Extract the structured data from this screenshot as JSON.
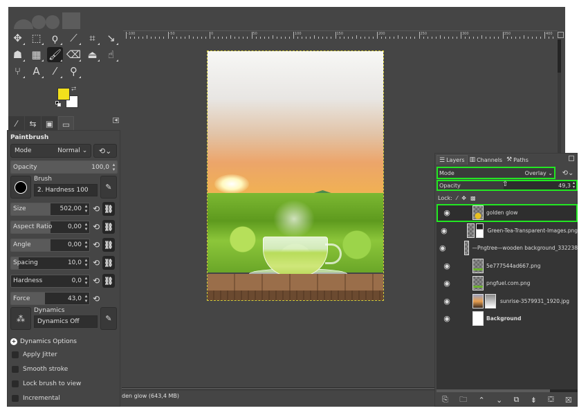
{
  "toolbox": {
    "tools": [
      {
        "name": "move-tool",
        "glyph": "✥"
      },
      {
        "name": "rect-select-tool",
        "glyph": "⬚"
      },
      {
        "name": "free-select-tool",
        "glyph": "ϙ"
      },
      {
        "name": "fuzzy-select-tool",
        "glyph": "⟋"
      },
      {
        "name": "crop-tool",
        "glyph": "⌗"
      },
      {
        "name": "unified-transform-tool",
        "glyph": "↘"
      },
      {
        "name": "warp-transform-tool",
        "glyph": "☗"
      },
      {
        "name": "gradient-tool",
        "glyph": "▦"
      },
      {
        "name": "paintbrush-tool",
        "glyph": "🖌",
        "active": true
      },
      {
        "name": "eraser-tool",
        "glyph": "⌫"
      },
      {
        "name": "clone-tool",
        "glyph": "⏏"
      },
      {
        "name": "smudge-tool",
        "glyph": "☝"
      },
      {
        "name": "paths-tool",
        "glyph": "⑂"
      },
      {
        "name": "text-tool",
        "glyph": "A"
      },
      {
        "name": "color-picker-tool",
        "glyph": "⁄"
      },
      {
        "name": "zoom-tool",
        "glyph": "⚲"
      }
    ],
    "foreground_color": "#f2e01c",
    "background_color": "#ffffff",
    "swap_glyph": "⮂",
    "dock_tabs": [
      {
        "name": "tool-options-tab",
        "glyph": "⁄"
      },
      {
        "name": "undo-history-tab",
        "glyph": "⇆"
      },
      {
        "name": "images-tab",
        "glyph": "▣"
      },
      {
        "name": "device-status-tab",
        "glyph": "▭"
      }
    ]
  },
  "tool_options": {
    "title": "Paintbrush",
    "mode_label": "Mode",
    "mode_value": "Normal",
    "opacity": {
      "label": "Opacity",
      "value": "100,0",
      "fraction": 1.0
    },
    "brush_label": "Brush",
    "brush_name": "2. Hardness 100",
    "sliders": [
      {
        "key": "size",
        "label": "Size",
        "value": "502,00",
        "fraction": 0.5,
        "has_chain": true
      },
      {
        "key": "aspect-ratio",
        "label": "Aspect Ratio",
        "value": "0,00",
        "fraction": 0.5,
        "has_chain": true
      },
      {
        "key": "angle",
        "label": "Angle",
        "value": "0,00",
        "fraction": 0.5,
        "has_chain": true
      },
      {
        "key": "spacing",
        "label": "Spacing",
        "value": "10,0",
        "fraction": 0.1,
        "has_chain": true
      },
      {
        "key": "hardness",
        "label": "Hardness",
        "value": "0,0",
        "fraction": 0.0,
        "has_chain": true
      },
      {
        "key": "force",
        "label": "Force",
        "value": "43,0",
        "fraction": 0.43,
        "has_chain": false
      }
    ],
    "dynamics_label": "Dynamics",
    "dynamics_value": "Dynamics Off",
    "dynamics_options_label": "Dynamics Options",
    "checkboxes": [
      {
        "label": "Apply Jitter",
        "checked": false
      },
      {
        "label": "Smooth stroke",
        "checked": false
      },
      {
        "label": "Lock brush to view",
        "checked": false
      },
      {
        "label": "Incremental",
        "checked": false
      }
    ]
  },
  "canvas": {
    "ruler_labels": [
      "-100",
      "-50",
      "0",
      "50",
      "100",
      "150",
      "200",
      "250",
      "300",
      "350",
      "400"
    ],
    "status_text": "den glow (643,4 MB)"
  },
  "layers_panel": {
    "tabs": [
      {
        "label": "Layers",
        "glyph": "☰",
        "active": true
      },
      {
        "label": "Channels",
        "glyph": "▥",
        "active": false
      },
      {
        "label": "Paths",
        "glyph": "⚒",
        "active": false
      }
    ],
    "mode_label": "Mode",
    "mode_value": "Overlay",
    "opacity_label": "Opacity",
    "opacity_value": "49,3",
    "opacity_fraction": 0.493,
    "lock_label": "Lock:",
    "highlight_color": "#22e822",
    "layers": [
      {
        "name": "golden glow",
        "visible": true,
        "selected": true,
        "has_mask": false,
        "thumb": "transparent-yellow"
      },
      {
        "name": "Green-Tea-Transparent-Images.png",
        "visible": true,
        "selected": false,
        "has_mask": true,
        "thumb": "transparent"
      },
      {
        "name": "—Pngtree—wooden background_332238",
        "visible": true,
        "selected": false,
        "has_mask": false,
        "thumb": "transparent"
      },
      {
        "name": "5e777544ad667.png",
        "visible": true,
        "selected": false,
        "has_mask": false,
        "thumb": "transparent-green"
      },
      {
        "name": "pngfuel.com.png",
        "visible": true,
        "selected": false,
        "has_mask": false,
        "thumb": "transparent-green"
      },
      {
        "name": "sunrise-3579931_1920.jpg",
        "visible": true,
        "selected": false,
        "has_mask": true,
        "thumb": "sunrise"
      },
      {
        "name": "Background",
        "visible": true,
        "selected": false,
        "has_mask": false,
        "thumb": "white",
        "bold": true
      }
    ],
    "buttons": [
      {
        "name": "new-layer-button",
        "glyph": "⎘"
      },
      {
        "name": "new-layer-group-button",
        "glyph": "🗀"
      },
      {
        "name": "raise-layer-button",
        "glyph": "⌃"
      },
      {
        "name": "lower-layer-button",
        "glyph": "⌄"
      },
      {
        "name": "duplicate-layer-button",
        "glyph": "⧉"
      },
      {
        "name": "merge-layer-button",
        "glyph": "⇟"
      },
      {
        "name": "add-mask-button",
        "glyph": "⛋"
      },
      {
        "name": "delete-layer-button",
        "glyph": "☒"
      }
    ]
  }
}
